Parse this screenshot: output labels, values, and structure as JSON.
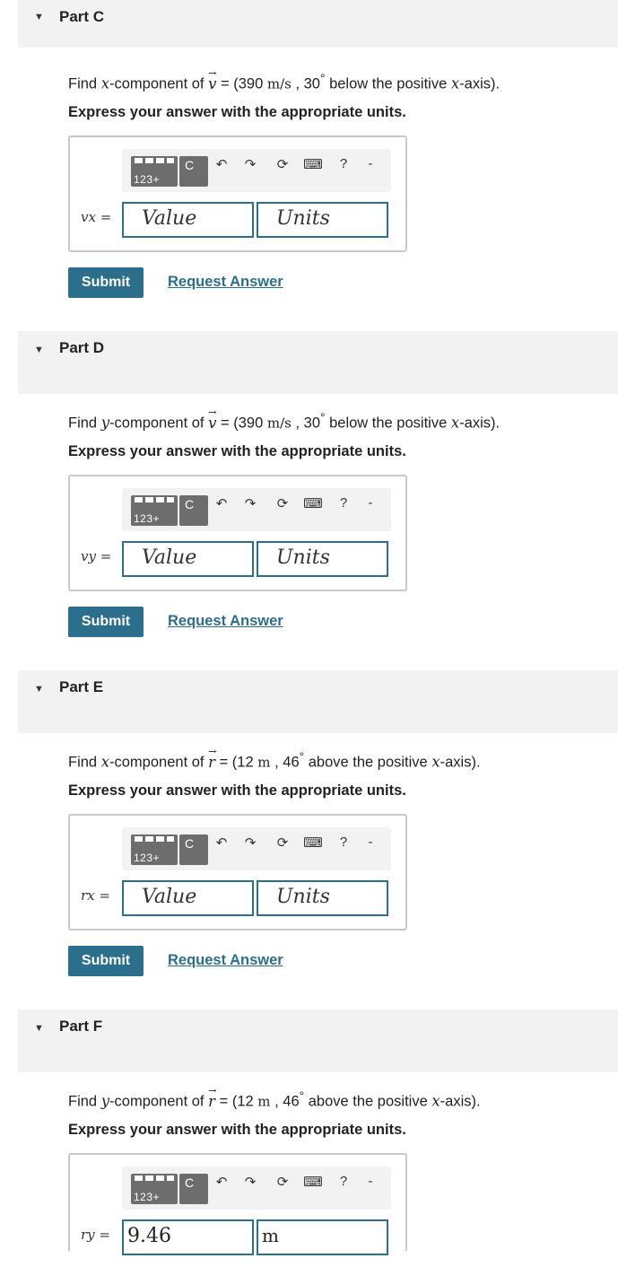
{
  "parts": [
    {
      "title": "Part C",
      "prompt": {
        "find": "Find",
        "comp_var": "x",
        "comp_suffix": "-component of",
        "vec": "v",
        "eq": "= (",
        "mag": "390",
        "unit": "m/s",
        "comma": ",",
        "angle": "30",
        "deg": "°",
        "tail": "below the positive",
        "axis_var": "x",
        "axis_suffix": "-axis)."
      },
      "instruction": "Express your answer with the appropriate units.",
      "eq_label": "vx =",
      "value": "",
      "value_placeholder": "Value",
      "units": "",
      "units_placeholder": "Units",
      "submit": "Submit",
      "request": "Request Answer"
    },
    {
      "title": "Part D",
      "prompt": {
        "find": "Find",
        "comp_var": "y",
        "comp_suffix": "-component of",
        "vec": "v",
        "eq": "= (",
        "mag": "390",
        "unit": "m/s",
        "comma": ",",
        "angle": "30",
        "deg": "°",
        "tail": "below the positive",
        "axis_var": "x",
        "axis_suffix": "-axis)."
      },
      "instruction": "Express your answer with the appropriate units.",
      "eq_label": "vy =",
      "value": "",
      "value_placeholder": "Value",
      "units": "",
      "units_placeholder": "Units",
      "submit": "Submit",
      "request": "Request Answer"
    },
    {
      "title": "Part E",
      "prompt": {
        "find": "Find",
        "comp_var": "x",
        "comp_suffix": "-component of",
        "vec": "r",
        "eq": "= (",
        "mag": "12",
        "unit": "m",
        "comma": ",",
        "angle": "46",
        "deg": "°",
        "tail": "above the positive",
        "axis_var": "x",
        "axis_suffix": "-axis)."
      },
      "instruction": "Express your answer with the appropriate units.",
      "eq_label": "rx =",
      "value": "",
      "value_placeholder": "Value",
      "units": "",
      "units_placeholder": "Units",
      "submit": "Submit",
      "request": "Request Answer"
    },
    {
      "title": "Part F",
      "prompt": {
        "find": "Find",
        "comp_var": "y",
        "comp_suffix": "-component of",
        "vec": "r",
        "eq": "= (",
        "mag": "12",
        "unit": "m",
        "comma": ",",
        "angle": "46",
        "deg": "°",
        "tail": "above the positive",
        "axis_var": "x",
        "axis_suffix": "-axis)."
      },
      "instruction": "Express your answer with the appropriate units.",
      "eq_label": "ry =",
      "value": "9.46",
      "value_placeholder": "Value",
      "units": "m",
      "units_placeholder": "Units"
    }
  ],
  "toolbar": {
    "keypad_label": "123+",
    "c_label": "C",
    "icons": [
      "undo-icon",
      "redo-icon",
      "reset-icon",
      "keyboard-icon",
      "help-icon"
    ],
    "help_label": "?",
    "dash_label": "-"
  }
}
